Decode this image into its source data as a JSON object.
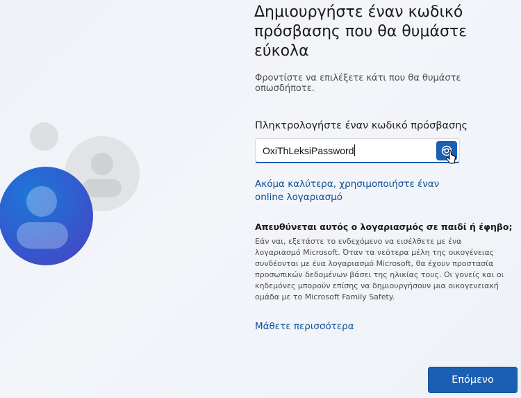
{
  "page": {
    "title": "Δημιουργήστε έναν κωδικό πρόσβασης που θα θυμάστε εύκολα",
    "subtitle": "Φροντίστε να επιλέξετε κάτι που θα θυμάστε οπωσδήποτε."
  },
  "password": {
    "label": "Πληκτρολογήστε έναν κωδικό πρόσβασης",
    "value": "OxiThLeksiPassword",
    "reveal_icon": "eye-icon"
  },
  "links": {
    "online_account": "Ακόμα καλύτερα, χρησιμοποιήστε έναν online λογαριασμό",
    "learn_more": "Μάθετε περισσότερα"
  },
  "child_section": {
    "heading": "Απευθύνεται αυτός ο λογαριασμός σε παιδί ή έφηβο;",
    "body": "Εάν ναι, εξετάστε το ενδεχόμενο να εισέλθετε με ένα λογαριασμό Microsoft. Όταν τα νεότερα μέλη της οικογένειας συνδέονται με ένα λογαριασμό Microsoft, θα έχουν προστασία προσωπικών δεδομένων βάσει της ηλικίας τους. Οι γονείς και οι κηδεμόνες μπορούν επίσης να δημιουργήσουν μια οικογενειακή ομάδα με το Microsoft Family Safety."
  },
  "buttons": {
    "next": "Επόμενο"
  },
  "colors": {
    "accent": "#1a5fb4",
    "link": "#0f4c95",
    "background": "#eef2f8"
  }
}
